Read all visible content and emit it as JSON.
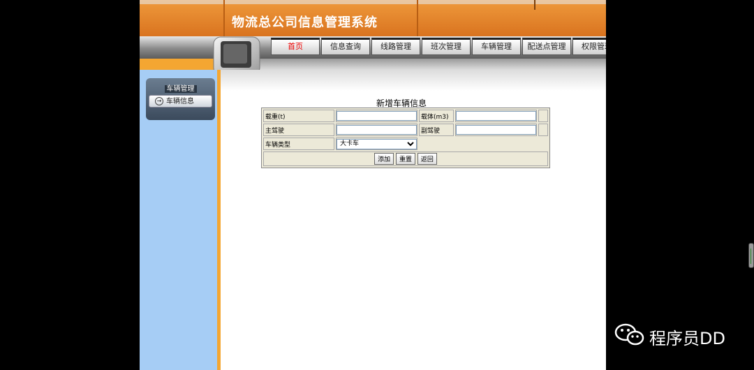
{
  "app": {
    "title": "物流总公司信息管理系统"
  },
  "nav": {
    "tabs": [
      {
        "label": "首页",
        "active": true
      },
      {
        "label": "信息查询"
      },
      {
        "label": "线路管理"
      },
      {
        "label": "班次管理"
      },
      {
        "label": "车辆管理"
      },
      {
        "label": "配送点管理"
      },
      {
        "label": "权限管理"
      }
    ]
  },
  "sidebar": {
    "menu_title": "车辆管理",
    "items": [
      {
        "label": "车辆信息"
      }
    ]
  },
  "form": {
    "title": "新增车辆信息",
    "fields": {
      "load_label": "载重(t)",
      "load_value": "",
      "volume_label": "载体(m3)",
      "volume_value": "",
      "driver_label": "主驾驶",
      "driver_value": "",
      "codriver_label": "副驾驶",
      "codriver_value": "",
      "type_label": "车辆类型",
      "type_selected": "大卡车"
    },
    "buttons": {
      "add": "添加",
      "reset": "重置",
      "back": "返回"
    }
  },
  "watermark": {
    "text": "程序员DD"
  },
  "colors": {
    "header_orange": "#e07f28",
    "sidebar_blue": "#a6cdf5",
    "active_tab_red": "#e00000"
  }
}
